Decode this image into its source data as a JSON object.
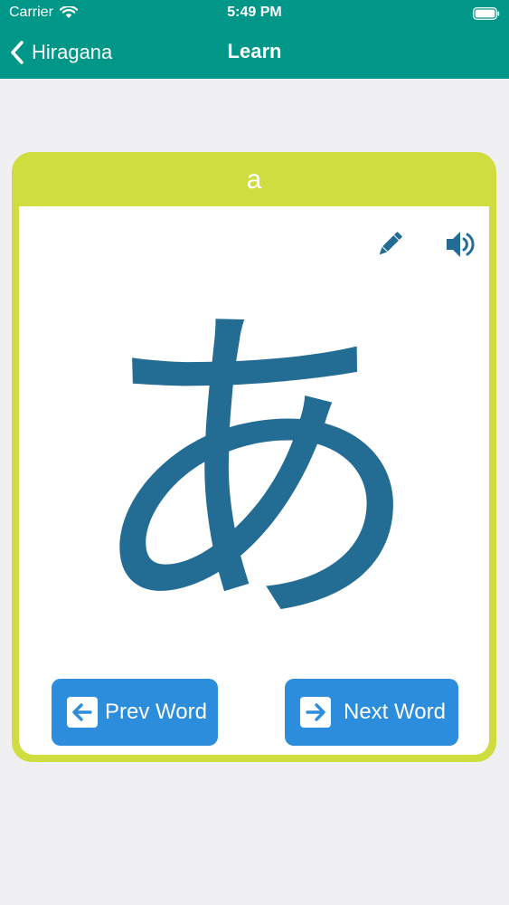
{
  "status_bar": {
    "carrier": "Carrier",
    "time": "5:49 PM"
  },
  "nav": {
    "back_label": "Hiragana",
    "title": "Learn"
  },
  "card": {
    "romaji": "a",
    "kana": "あ",
    "prev_label": "Prev Word",
    "next_label": "Next Word"
  },
  "colors": {
    "header": "#009688",
    "card_border": "#cfdd3e",
    "kana": "#236d95",
    "button": "#2b8ddb",
    "background": "#f0f0f2"
  },
  "icons": {
    "edit": "pencil-icon",
    "audio": "speaker-icon",
    "prev": "arrow-left-icon",
    "next": "arrow-right-icon",
    "back": "chevron-left-icon"
  }
}
